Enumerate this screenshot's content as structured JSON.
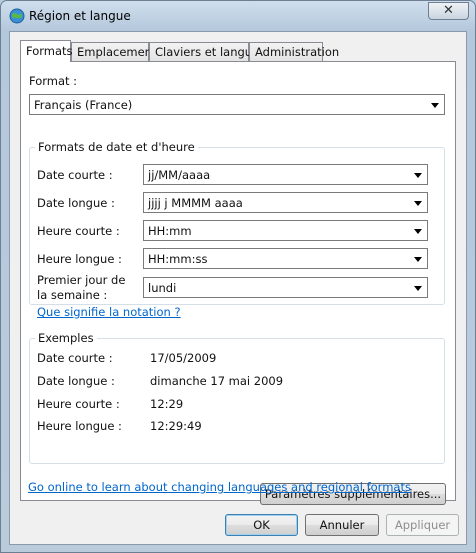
{
  "window": {
    "title": "Région et langue",
    "close_glyph": "✕"
  },
  "tabs": [
    {
      "label": "Formats",
      "active": true
    },
    {
      "label": "Emplacement",
      "active": false
    },
    {
      "label": "Claviers et langues",
      "active": false
    },
    {
      "label": "Administration",
      "active": false
    }
  ],
  "formats": {
    "format_label": "Format :",
    "format_value": "Français (France)",
    "date_time_group": {
      "title": "Formats de date et d'heure",
      "short_date": {
        "label": "Date courte :",
        "value": "jj/MM/aaaa"
      },
      "long_date": {
        "label": "Date longue :",
        "value": "jjjj j MMMM aaaa"
      },
      "short_time": {
        "label": "Heure courte :",
        "value": "HH:mm"
      },
      "long_time": {
        "label": "Heure longue :",
        "value": "HH:mm:ss"
      },
      "first_day": {
        "label_line1": "Premier jour de",
        "label_line2": "la semaine :",
        "value": "lundi"
      }
    },
    "notation_link": "Que signifie la notation ?",
    "examples_group": {
      "title": "Exemples",
      "short_date": {
        "label": "Date courte :",
        "value": "17/05/2009"
      },
      "long_date": {
        "label": "Date longue :",
        "value": "dimanche 17 mai 2009"
      },
      "short_time": {
        "label": "Heure courte :",
        "value": "12:29"
      },
      "long_time": {
        "label": "Heure longue :",
        "value": "12:29:49"
      }
    },
    "additional_settings_button": "Paramètres supplémentaires...",
    "online_link": "Go online to learn about changing languages and regional formats"
  },
  "footer": {
    "ok": "OK",
    "cancel": "Annuler",
    "apply": "Appliquer"
  },
  "colors": {
    "link": "#0066cc",
    "title_bar": "#b9cde0"
  }
}
